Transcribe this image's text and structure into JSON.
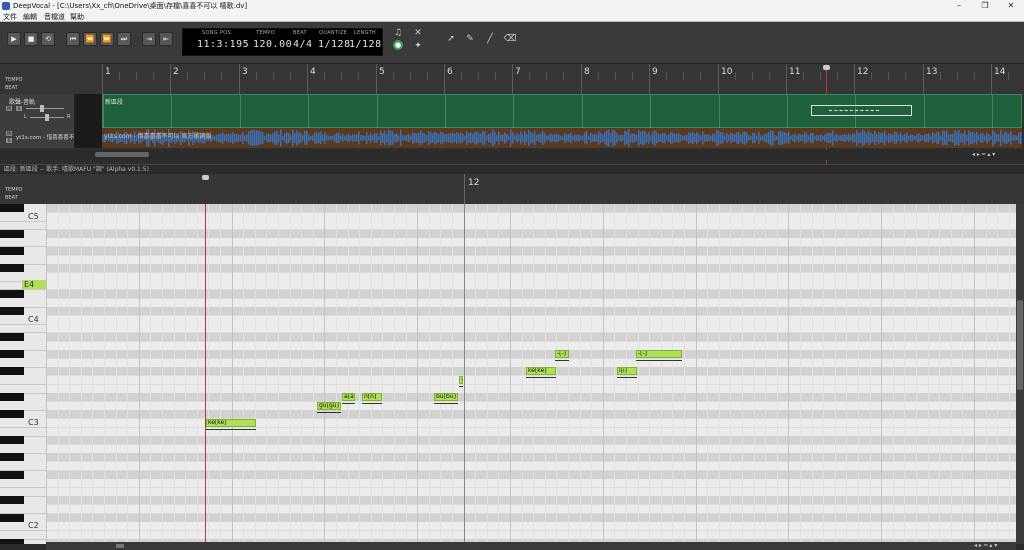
{
  "window": {
    "title": "DeepVocal - [C:\\Users\\Xx_cfi\\OneDrive\\桌面\\存檔\\喜喜不可以 嘻歌.dv]"
  },
  "menu": [
    "文件",
    "編輯",
    "音檔道",
    "幫助"
  ],
  "transport": {
    "song_pos_label": "SONG POS.",
    "song_pos": "11:3:195",
    "tempo_label": "TEMPO",
    "tempo": "120.00",
    "beat_label": "BEAT",
    "beat": "4/4",
    "quantize_label": "QUANTIZE",
    "quantize": "1/128",
    "length_label": "LENGTH",
    "length": "1/128"
  },
  "arrangement": {
    "tempo_label": "TEMPO",
    "beat_label": "BEAT",
    "bars": [
      "1",
      "2",
      "3",
      "4",
      "5",
      "6",
      "7",
      "8",
      "9",
      "10",
      "11",
      "12",
      "13",
      "14"
    ],
    "track1": {
      "name": "歌聲-音軌",
      "segment_label": "新區段",
      "m": "M",
      "s": "S",
      "l": "L",
      "r": "R"
    },
    "track2": {
      "name": "yt1s.com - 惜喜喜喜不",
      "audio_label": "yt1s.com - 惜喜喜喜不可以 官方歌詞版",
      "m": "M",
      "s": "S"
    }
  },
  "piano_roll": {
    "info": "區段: 新區段  --  歌手: 嘻歌MAFU \"調\" (Alpha v0.1.5)",
    "tempo_label": "TEMPO",
    "beat_label": "BEAT",
    "bar_label": "12",
    "keys": [
      "C5",
      "E4",
      "C4",
      "C3",
      "C2"
    ],
    "notes": [
      {
        "lyric": "ke[ke]",
        "start": 0,
        "pitch": 48
      },
      {
        "lyric": "gu[gu]",
        "start": 1,
        "pitch": 50
      },
      {
        "lyric": "a[a]",
        "start": 2,
        "pitch": 51
      },
      {
        "lyric": "n[n]",
        "start": 3,
        "pitch": 51
      },
      {
        "lyric": "bu[bu]",
        "start": 4,
        "pitch": 51
      },
      {
        "lyric": "-",
        "start": 5,
        "pitch": 53
      },
      {
        "lyric": "ke[ke]",
        "start": 6,
        "pitch": 54
      },
      {
        "lyric": "-[-]",
        "start": 7,
        "pitch": 56
      },
      {
        "lyric": "i[i]",
        "start": 8,
        "pitch": 54
      },
      {
        "lyric": "-[-]",
        "start": 9,
        "pitch": 56
      }
    ]
  },
  "colors": {
    "segment": "#1e5f3c",
    "audio": "#5a3a1e",
    "note": "#aee05a",
    "playhead": "#b53a3a",
    "waveform": "#3a6fb8"
  }
}
